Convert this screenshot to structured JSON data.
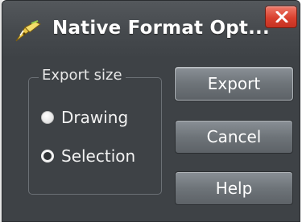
{
  "window": {
    "title": "Native Format Opt...",
    "app_icon": "pen-nib-icon",
    "close_icon": "close-icon"
  },
  "export_size": {
    "legend": "Export size",
    "options": [
      {
        "label": "Drawing",
        "selected": false
      },
      {
        "label": "Selection",
        "selected": true
      }
    ]
  },
  "buttons": {
    "export": "Export",
    "cancel": "Cancel",
    "help": "Help"
  },
  "colors": {
    "window_bg": "#3e4246",
    "close_red": "#d9412f",
    "button_gray": "#6e7479",
    "text": "#ffffff"
  }
}
